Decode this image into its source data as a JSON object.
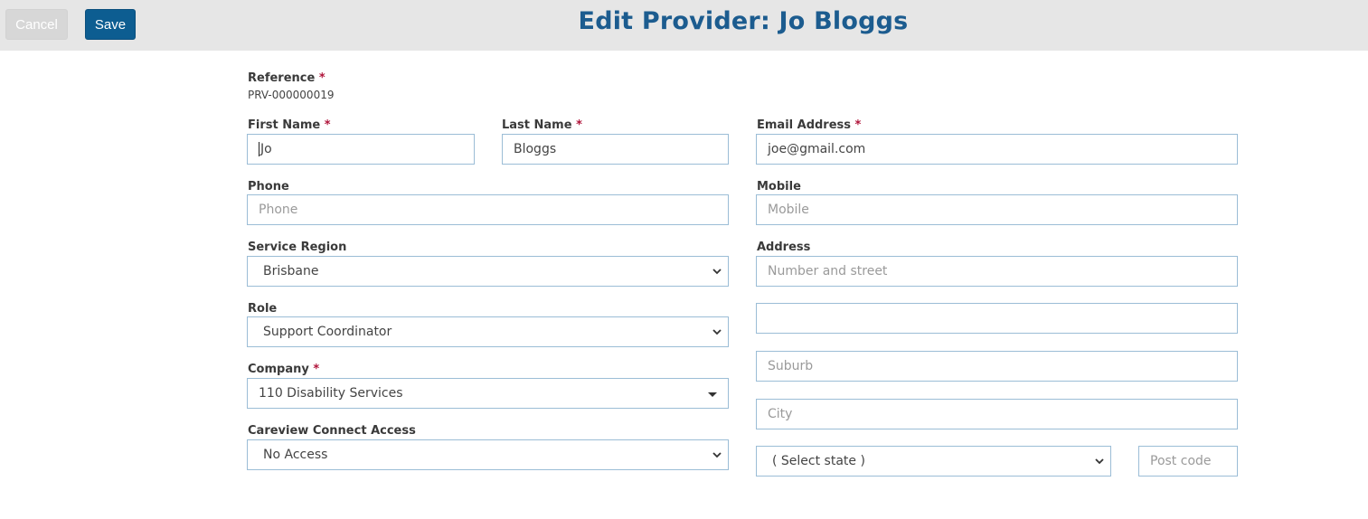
{
  "toolbar": {
    "cancel_label": "Cancel",
    "save_label": "Save"
  },
  "header": {
    "title": "Edit Provider: Jo Bloggs"
  },
  "required_mark": "*",
  "form": {
    "reference": {
      "label": "Reference",
      "value": "PRV-000000019"
    },
    "first_name": {
      "label": "First Name",
      "value": "Jo"
    },
    "last_name": {
      "label": "Last Name",
      "value": "Bloggs"
    },
    "email": {
      "label": "Email Address",
      "value": "joe@gmail.com"
    },
    "phone": {
      "label": "Phone",
      "placeholder": "Phone"
    },
    "mobile": {
      "label": "Mobile",
      "placeholder": "Mobile"
    },
    "service_region": {
      "label": "Service Region",
      "value": "Brisbane"
    },
    "address": {
      "label": "Address",
      "line1_placeholder": "Number and street",
      "line2_value": "",
      "suburb_placeholder": "Suburb",
      "city_placeholder": "City",
      "state_value": "( Select state )",
      "postcode_placeholder": "Post code"
    },
    "role": {
      "label": "Role",
      "value": "Support Coordinator"
    },
    "company": {
      "label": "Company",
      "value": "110 Disability Services"
    },
    "careview_access": {
      "label": "Careview Connect Access",
      "value": "No Access"
    }
  },
  "icons": {
    "select_arrow": "chevron-down-icon",
    "dropdown_caret": "caret-down-icon"
  },
  "colors": {
    "title": "#1c5c8f",
    "save_button": "#0d5d91",
    "required": "#b0143a",
    "field_border": "#9bbdd6",
    "topbar": "#e6e6e6"
  }
}
